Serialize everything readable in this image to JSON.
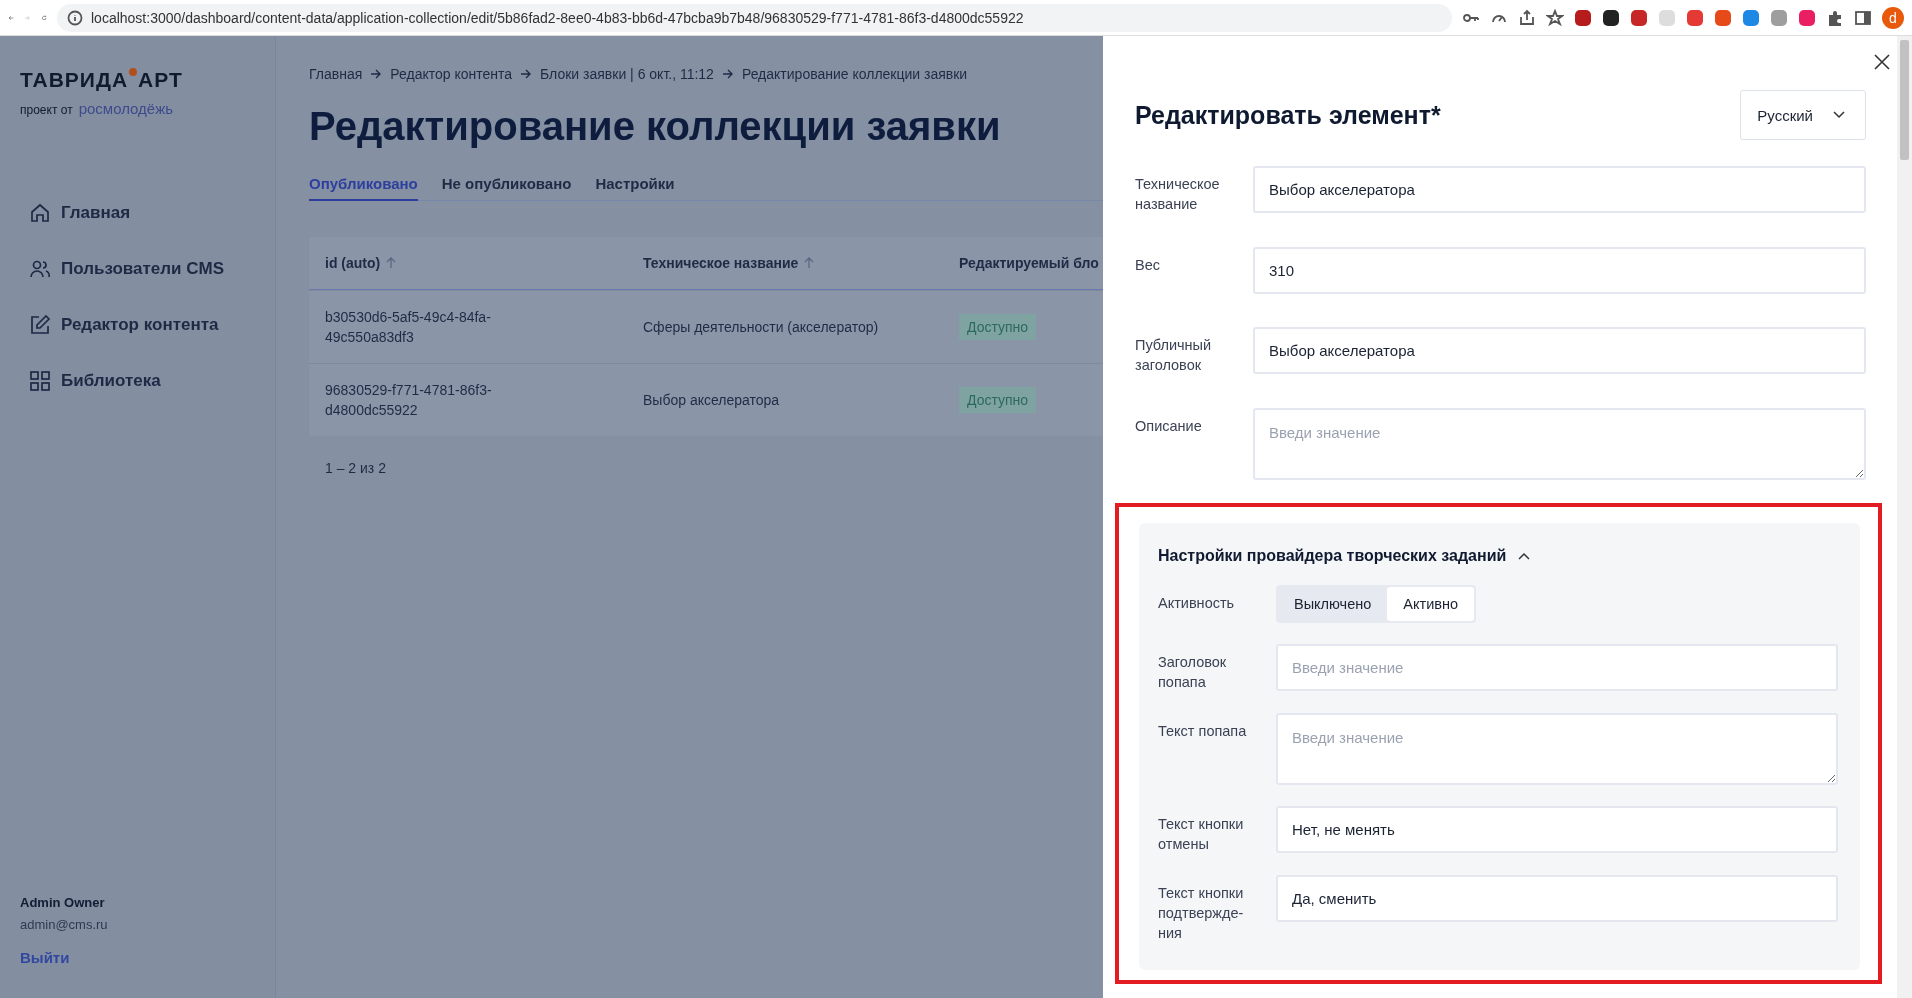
{
  "browser": {
    "url": "localhost:3000/dashboard/content-data/application-collection/edit/5b86fad2-8ee0-4b83-bb6d-47bcba9b7b48/96830529-f771-4781-86f3-d4800dc55922",
    "avatar_letter": "d"
  },
  "sidebar": {
    "logo": {
      "part1": "ТАВРИДА",
      "part2": "АРТ",
      "prefix": "проект от",
      "brand": "росмолодёжь"
    },
    "items": [
      {
        "label": "Главная",
        "kind": "home"
      },
      {
        "label": "Пользователи CMS",
        "kind": "users"
      },
      {
        "label": "Редактор контента",
        "kind": "edit"
      },
      {
        "label": "Библиотека",
        "kind": "grid"
      }
    ],
    "user": {
      "name": "Admin Owner",
      "email": "admin@cms.ru",
      "logout": "Выйти"
    }
  },
  "main": {
    "breadcrumbs": [
      "Главная",
      "Редактор контента",
      "Блоки заявки | 6 окт., 11:12",
      "Редактирование коллекции заявки"
    ],
    "title": "Редактирование коллекции заявки",
    "tabs": [
      {
        "label": "Опубликовано",
        "selected": true
      },
      {
        "label": "Не опубликовано",
        "selected": false
      },
      {
        "label": "Настройки",
        "selected": false
      }
    ],
    "table": {
      "columns": [
        {
          "label": "id (auto)",
          "sortable": true
        },
        {
          "label": "Техническое название",
          "sortable": true
        },
        {
          "label": "Редактируемый бло"
        }
      ],
      "rows": [
        {
          "id": "b30530d6-5af5-49c4-84fa-49c550a83df3",
          "name": "Сферы деятельности (акселератор)",
          "status": "Доступно"
        },
        {
          "id": "96830529-f771-4781-86f3-d4800dc55922",
          "name": "Выбор акселератора",
          "status": "Доступно"
        }
      ]
    },
    "pagination": "1 – 2 из 2"
  },
  "drawer": {
    "title": "Редактировать элемент*",
    "language": "Русский",
    "fields": [
      {
        "kind": "input",
        "label": "Техническое название",
        "value": "Выбор акселератора"
      },
      {
        "kind": "input",
        "label": "Вес",
        "value": "310"
      },
      {
        "kind": "input",
        "label": "Публичный заголовок",
        "value": "Выбор акселератора"
      },
      {
        "kind": "textarea",
        "label": "Описание",
        "placeholder": "Введи значение"
      }
    ],
    "section": {
      "title": "Настройки провайдера творческих заданий",
      "expanded": true,
      "highlighted": true,
      "fields": [
        {
          "kind": "segmented",
          "label": "Активность",
          "options": [
            {
              "label": "Выключено",
              "selected": false
            },
            {
              "label": "Активно",
              "selected": true
            }
          ]
        },
        {
          "kind": "input",
          "label": "Заголовок попапа",
          "placeholder": "Введи значение"
        },
        {
          "kind": "textarea",
          "label": "Текст попапа",
          "placeholder": "Введи значение"
        },
        {
          "kind": "input",
          "label": "Текст кнопки отмены",
          "value": "Нет, не менять"
        },
        {
          "kind": "input",
          "label": "Текст кнопки подтвержде-ния",
          "value": "Да, сменить"
        }
      ]
    }
  }
}
